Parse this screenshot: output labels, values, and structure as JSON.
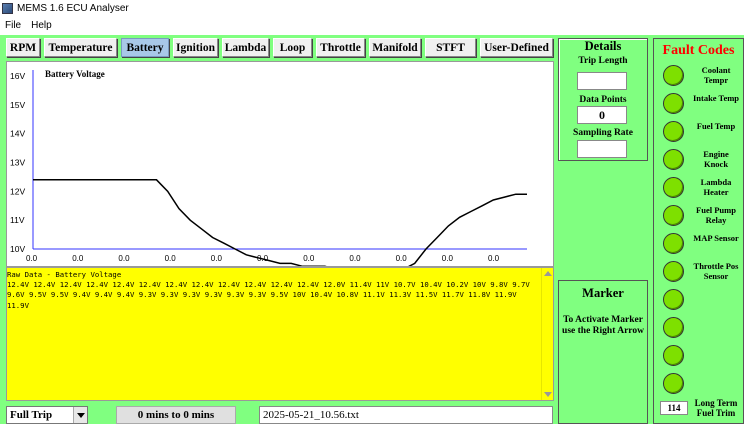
{
  "window": {
    "title": "MEMS 1.6 ECU Analyser",
    "icon": "app-icon"
  },
  "menu": [
    "File",
    "Help"
  ],
  "tabs": [
    {
      "label": "RPM",
      "active": false
    },
    {
      "label": "Temperature",
      "active": false
    },
    {
      "label": "Battery",
      "active": true
    },
    {
      "label": "Ignition",
      "active": false
    },
    {
      "label": "Lambda",
      "active": false
    },
    {
      "label": "Loop",
      "active": false
    },
    {
      "label": "Throttle",
      "active": false
    },
    {
      "label": "Manifold",
      "active": false
    },
    {
      "label": "STFT",
      "active": false
    },
    {
      "label": "User-Defined",
      "active": false
    }
  ],
  "chart_data": {
    "type": "line",
    "title": "Battery Voltage",
    "y_ticks": [
      "16V",
      "15V",
      "14V",
      "13V",
      "12V",
      "11V",
      "10V"
    ],
    "x_ticks": [
      "0.0",
      "0.0",
      "0.0",
      "0.0",
      "0.0",
      "0.0",
      "0.0",
      "0.0",
      "0.0",
      "0.0",
      "0.0"
    ],
    "ylim": [
      10,
      16
    ],
    "series": [
      {
        "color": "#000000",
        "values": [
          12.4,
          12.4,
          12.4,
          12.4,
          12.4,
          12.4,
          12.4,
          12.4,
          12.4,
          12.4,
          12.4,
          12.4,
          12.0,
          11.4,
          11.0,
          10.7,
          10.4,
          10.2,
          10.0,
          9.8,
          9.7,
          9.6,
          9.5,
          9.5,
          9.4,
          9.4,
          9.4,
          9.3,
          9.3,
          9.3,
          9.3,
          9.3,
          9.3,
          9.3,
          9.5,
          10.0,
          10.4,
          10.8,
          11.1,
          11.3,
          11.5,
          11.7,
          11.8,
          11.9,
          11.9
        ]
      }
    ],
    "baseline_color": "#3333ff"
  },
  "raw_data": {
    "title": "Raw Data - Battery Voltage",
    "values": "12.4V 12.4V 12.4V 12.4V 12.4V 12.4V 12.4V 12.4V 12.4V 12.4V 12.4V 12.4V 12.0V 11.4V 11V 10.7V 10.4V 10.2V 10V 9.8V 9.7V 9.6V 9.5V 9.5V 9.4V 9.4V 9.4V 9.3V 9.3V 9.3V 9.3V 9.3V 9.3V 9.5V 10V 10.4V 10.8V 11.1V 11.3V 11.5V 11.7V 11.8V 11.9V 11.9V"
  },
  "bottom": {
    "trip_select": "Full Trip",
    "time_range": "0 mins to 0 mins",
    "file_name": "2025-05-21_10.56.txt"
  },
  "details": {
    "title": "Details",
    "trip_length_label": "Trip Length",
    "trip_length_value": "",
    "data_points_label": "Data Points",
    "data_points_value": "0",
    "sampling_rate_label": "Sampling Rate",
    "sampling_rate_value": ""
  },
  "marker": {
    "title": "Marker",
    "instructions": "To Activate Marker use the Right Arrow"
  },
  "fault_codes": {
    "title": "Fault Codes",
    "title_color": "#ff0000",
    "led_color": "#7ee000",
    "items": [
      {
        "label": "Coolant Tempr"
      },
      {
        "label": "Intake Temp"
      },
      {
        "label": "Fuel Temp"
      },
      {
        "label": "Engine Knock"
      },
      {
        "label": "Lambda Heater"
      },
      {
        "label": "Fuel Pump Relay"
      },
      {
        "label": "MAP Sensor"
      },
      {
        "label": "Throttle Pos Sensor"
      },
      {
        "label": ""
      },
      {
        "label": ""
      },
      {
        "label": ""
      },
      {
        "label": ""
      }
    ],
    "ltft_value": "114",
    "ltft_label": "Long Term Fuel Trim"
  }
}
